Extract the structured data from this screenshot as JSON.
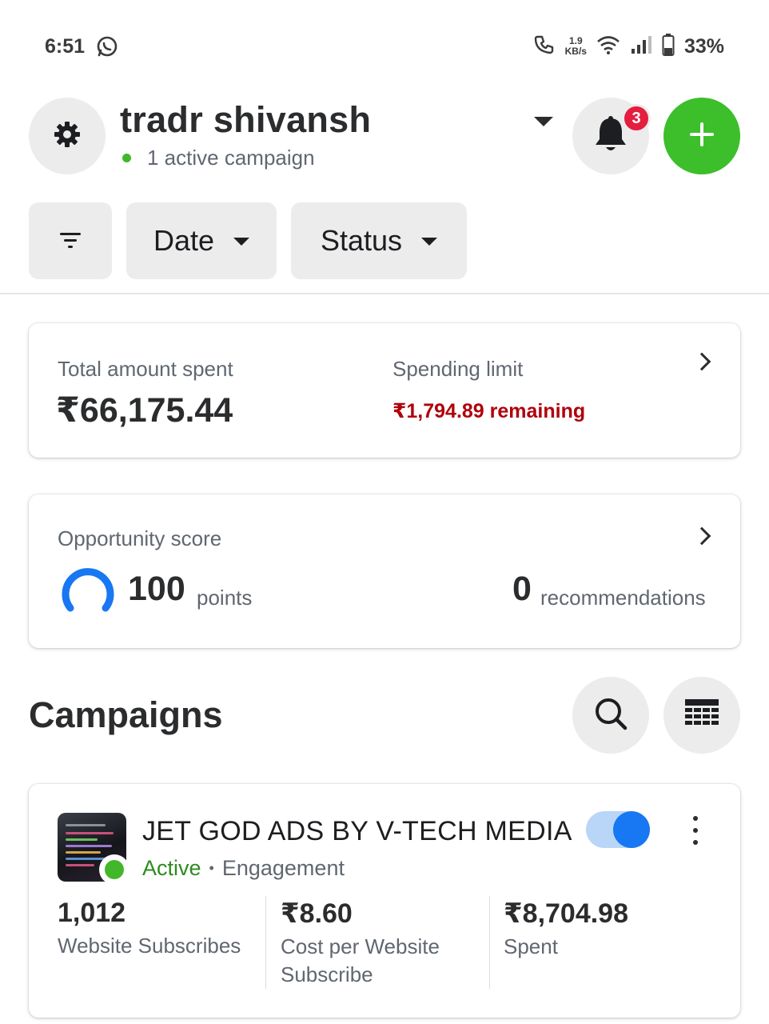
{
  "status_bar": {
    "time": "6:51",
    "net_speed_value": "1.9",
    "net_speed_unit": "KB/s",
    "battery": "33%"
  },
  "header": {
    "account_name": "tradr shivansh",
    "account_status": "1 active campaign",
    "notification_count": "3"
  },
  "filters": {
    "date_label": "Date",
    "status_label": "Status"
  },
  "spend_card": {
    "total_label": "Total amount spent",
    "total_value": "₹66,175.44",
    "limit_label": "Spending limit",
    "limit_remaining": "₹1,794.89 remaining"
  },
  "opportunity_card": {
    "label": "Opportunity score",
    "score": "100",
    "score_unit": "points",
    "recommendations_count": "0",
    "recommendations_label": "recommendations"
  },
  "campaigns": {
    "title": "Campaigns",
    "items": [
      {
        "name": "JET GOD ADS BY V-TECH MEDIA",
        "status": "Active",
        "objective": "Engagement",
        "enabled": true,
        "metrics": [
          {
            "value": "1,012",
            "label": "Website Subscribes"
          },
          {
            "value": "₹8.60",
            "label": "Cost per Website Subscribe"
          },
          {
            "value": "₹8,704.98",
            "label": "Spent"
          }
        ]
      }
    ]
  },
  "colors": {
    "accent_blue": "#1877f2",
    "add_green": "#3cbf2a",
    "active_green": "#2e8b20",
    "warning_red": "#b0000b",
    "badge_red": "#e41e3f"
  },
  "icons": [
    "whatsapp-icon",
    "call-icon",
    "wifi-icon",
    "signal-icon",
    "battery-icon",
    "gear-icon",
    "bell-icon",
    "plus-icon",
    "filter-icon",
    "search-icon",
    "table-icon",
    "chevron-right-icon",
    "more-icon"
  ]
}
